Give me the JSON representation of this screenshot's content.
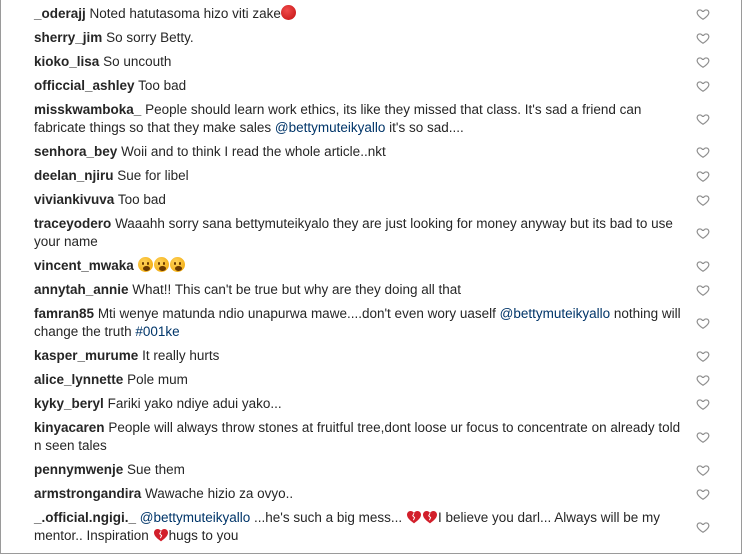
{
  "comments": [
    {
      "user": "_oderajj",
      "parts": [
        {
          "t": "Noted hatutasoma hizo viti zake"
        },
        {
          "e": "angry"
        }
      ]
    },
    {
      "user": "sherry_jim",
      "parts": [
        {
          "t": "So sorry Betty."
        }
      ]
    },
    {
      "user": "kioko_lisa",
      "parts": [
        {
          "t": "So uncouth"
        }
      ]
    },
    {
      "user": "officcial_ashley",
      "parts": [
        {
          "t": "Too bad"
        }
      ]
    },
    {
      "user": "misskwamboka_",
      "parts": [
        {
          "t": "People should learn work ethics, its like they missed that class. It's sad a friend can fabricate things so that they make sales "
        },
        {
          "m": "@bettymuteikyallo"
        },
        {
          "t": " it's so sad...."
        }
      ]
    },
    {
      "user": "senhora_bey",
      "parts": [
        {
          "t": "Woii and to think I read the whole article..nkt"
        }
      ]
    },
    {
      "user": "deelan_njiru",
      "parts": [
        {
          "t": "Sue for libel"
        }
      ]
    },
    {
      "user": "viviankivuva",
      "parts": [
        {
          "t": "Too bad"
        }
      ]
    },
    {
      "user": "traceyodero",
      "parts": [
        {
          "t": "Waaahh sorry sana bettymuteikyalo they are just looking for money anyway but its bad to use your name"
        }
      ]
    },
    {
      "user": "vincent_mwaka",
      "parts": [
        {
          "e": "sad"
        },
        {
          "e": "sad"
        },
        {
          "e": "sad"
        }
      ]
    },
    {
      "user": "annytah_annie",
      "parts": [
        {
          "t": "What!! This can't be true but why are they doing all that"
        }
      ]
    },
    {
      "user": "famran85",
      "parts": [
        {
          "t": "Mti wenye matunda ndio unapurwa mawe....don't even wory uaself "
        },
        {
          "m": "@bettymuteikyallo"
        },
        {
          "t": " nothing will change the truth "
        },
        {
          "m": "#001ke"
        }
      ]
    },
    {
      "user": "kasper_murume",
      "parts": [
        {
          "t": "It really hurts"
        }
      ]
    },
    {
      "user": "alice_lynnette",
      "parts": [
        {
          "t": "Pole mum"
        }
      ]
    },
    {
      "user": "kyky_beryl",
      "parts": [
        {
          "t": "Fariki yako ndiye adui yako..."
        }
      ]
    },
    {
      "user": "kinyacaren",
      "parts": [
        {
          "t": "People will always throw stones at fruitful tree,dont loose ur focus to concentrate on already told n seen tales"
        }
      ]
    },
    {
      "user": "pennymwenje",
      "parts": [
        {
          "t": "Sue them"
        }
      ]
    },
    {
      "user": "armstrongandira",
      "parts": [
        {
          "t": "Wawache hizio za ovyo.."
        }
      ]
    },
    {
      "user": "_.official.ngigi._",
      "parts": [
        {
          "m": "@bettymuteikyallo"
        },
        {
          "t": " ...he's such a big mess... "
        },
        {
          "e": "heart"
        },
        {
          "e": "heart"
        },
        {
          "t": "I believe you darl... Always will be my mentor.. Inspiration "
        },
        {
          "e": "heart"
        },
        {
          "t": "hugs to you"
        }
      ]
    }
  ],
  "icons": {
    "like": "heart-outline-icon"
  },
  "colors": {
    "text": "#262626",
    "mention": "#003569",
    "icon": "#8e8e8e"
  }
}
